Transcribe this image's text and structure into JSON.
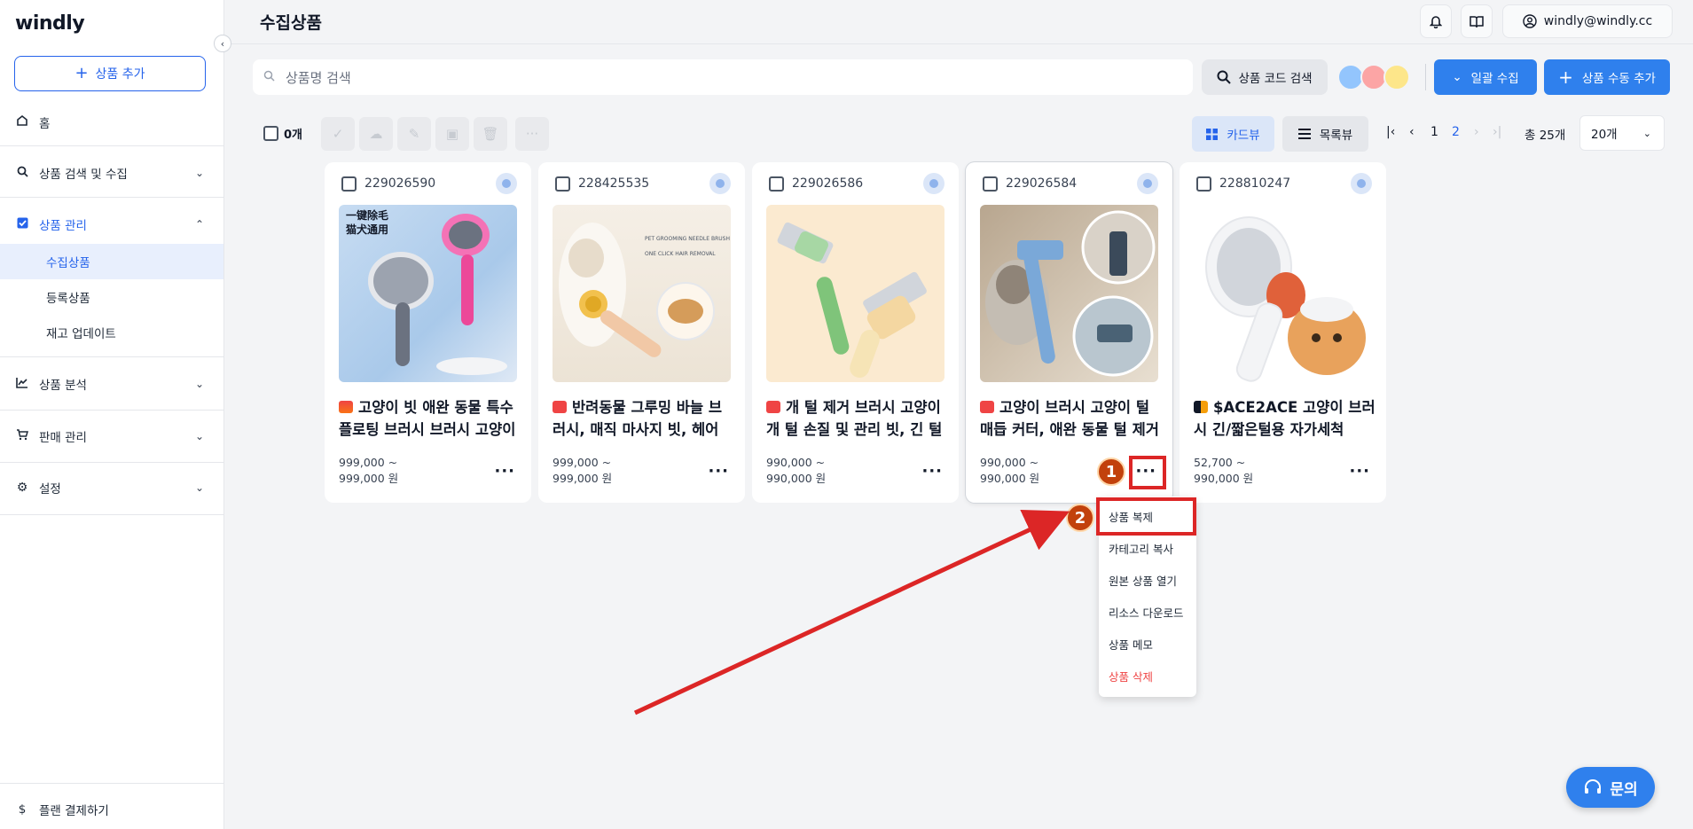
{
  "app": {
    "logo": "windly"
  },
  "sidebar": {
    "add_product": "상품 추가",
    "home": "홈",
    "groups": [
      {
        "label": "상품 검색 및 수집"
      },
      {
        "label": "상품 관리",
        "items": [
          "수집상품",
          "등록상품",
          "재고 업데이트"
        ]
      },
      {
        "label": "상품 분석"
      },
      {
        "label": "판매 관리"
      },
      {
        "label": "설정"
      }
    ],
    "plan": "플랜 결제하기"
  },
  "header": {
    "title": "수집상품",
    "user_email": "windly@windly.cc"
  },
  "toolbar": {
    "search_placeholder": "상품명 검색",
    "code_search": "상품 코드 검색",
    "bulk_collect": "일괄 수집",
    "manual_add": "상품 수동 추가"
  },
  "list_controls": {
    "selected_count": "0개",
    "card_view": "카드뷰",
    "list_view": "목록뷰",
    "pages": [
      "1",
      "2"
    ],
    "current_page": "2",
    "total": "총 25개",
    "per_page": "20개"
  },
  "cards": [
    {
      "id": "229026590",
      "title": "고양이 빗 애완 동물 특수 플로팅 브러시 브러시 고양이 털 제거",
      "price_min": "999,000 ~",
      "price_max": "999,000 원",
      "shop": "ali"
    },
    {
      "id": "228425535",
      "title": "반려동물 그루밍 바늘 브러시, 매직 마사지 빗, 헤어 제거",
      "price_min": "999,000 ~",
      "price_max": "999,000 원",
      "shop": "tmall"
    },
    {
      "id": "229026586",
      "title": "개 털 제거 브러시 고양이 개 털 손질 및 관리 빗, 긴 털",
      "price_min": "990,000 ~",
      "price_max": "990,000 원",
      "shop": "tmall"
    },
    {
      "id": "229026584",
      "title": "고양이 브러시 고양이 털 매듭 커터, 애완 동물 털 제거기",
      "price_min": "990,000 ~",
      "price_max": "990,000 원",
      "shop": "tmall"
    },
    {
      "id": "228810247",
      "title": "$ACE2ACE 고양이 브러시 긴/짧은털용 자가세척",
      "price_min": "52,700 ~",
      "price_max": "990,000 원",
      "shop": "dom"
    }
  ],
  "image_text": {
    "card1_line1": "一键除毛",
    "card1_line2": "猫犬通用",
    "card2_line1": "PET GROOMING NEEDLE BRUSH",
    "card2_line2": "ONE CLICK HAIR REMOVAL"
  },
  "context_menu": {
    "items": [
      "상품 복제",
      "카테고리 복사",
      "원본 상품 열기",
      "리소스 다운로드",
      "상품 메모",
      "상품 삭제"
    ]
  },
  "annotations": {
    "step1": "1",
    "step2": "2"
  },
  "inquiry": "문의",
  "colors": {
    "accent": "#2f80ed",
    "highlight": "#dc2626",
    "danger": "#ef4444"
  }
}
